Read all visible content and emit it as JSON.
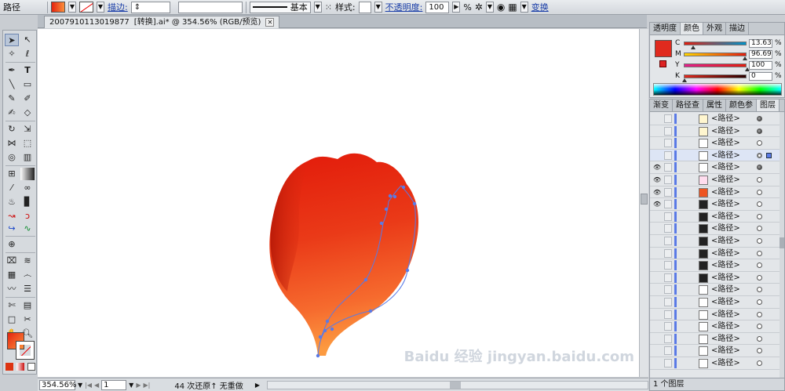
{
  "control_bar": {
    "object_type": "路径",
    "stroke_label": "描边:",
    "stroke_profile": "基本",
    "style_label": "样式:",
    "opacity_label": "不透明度:",
    "opacity_value": "100",
    "opacity_unit": "%",
    "transform_label": "变换"
  },
  "document": {
    "file_id": "200791011301987​7",
    "tab_title": "[转换].ai* @ 354.56% (RGB/预览)",
    "zoom": "354.56%",
    "artboard": "1",
    "history_status": "44 次还原↑ 无重做"
  },
  "color_panel": {
    "tabs": [
      "透明度",
      "颜色",
      "外观",
      "描边"
    ],
    "active_tab": "颜色",
    "channels": [
      {
        "label": "C",
        "value": "13.63",
        "percent": 13.63
      },
      {
        "label": "M",
        "value": "96.69",
        "percent": 96.69
      },
      {
        "label": "Y",
        "value": "100",
        "percent": 100
      },
      {
        "label": "K",
        "value": "0",
        "percent": 0
      }
    ],
    "fill_color": "#e02a1e"
  },
  "layers_panel": {
    "tabs": [
      "渐变",
      "路径查",
      "属性",
      "颜色参",
      "图层"
    ],
    "active_tab": "图层",
    "rows": [
      {
        "name": "<路径>",
        "visible": false,
        "target": "filled"
      },
      {
        "name": "<路径>",
        "visible": false,
        "target": "filled"
      },
      {
        "name": "<路径>",
        "visible": false,
        "target": "empty"
      },
      {
        "name": "<路径>",
        "visible": false,
        "target": "selected"
      },
      {
        "name": "<路径>",
        "visible": true,
        "target": "filled"
      },
      {
        "name": "<路径>",
        "visible": true,
        "target": "empty"
      },
      {
        "name": "<路径>",
        "visible": true,
        "target": "empty"
      },
      {
        "name": "<路径>",
        "visible": true,
        "target": "empty"
      },
      {
        "name": "<路径>",
        "visible": false,
        "target": "empty"
      },
      {
        "name": "<路径>",
        "visible": false,
        "target": "empty"
      },
      {
        "name": "<路径>",
        "visible": false,
        "target": "empty"
      },
      {
        "name": "<路径>",
        "visible": false,
        "target": "empty"
      },
      {
        "name": "<路径>",
        "visible": false,
        "target": "empty"
      },
      {
        "name": "<路径>",
        "visible": false,
        "target": "empty"
      },
      {
        "name": "<路径>",
        "visible": false,
        "target": "empty"
      },
      {
        "name": "<路径>",
        "visible": false,
        "target": "empty"
      },
      {
        "name": "<路径>",
        "visible": false,
        "target": "empty"
      },
      {
        "name": "<路径>",
        "visible": false,
        "target": "empty"
      },
      {
        "name": "<路径>",
        "visible": false,
        "target": "empty"
      },
      {
        "name": "<路径>",
        "visible": false,
        "target": "empty"
      },
      {
        "name": "<路径>",
        "visible": false,
        "target": "empty"
      }
    ],
    "footer": "1 个图层"
  },
  "colors": {
    "accent": "#5a7ae6",
    "petal_top": "#e4230f",
    "petal_bottom": "#fb8f3c"
  },
  "watermark": "Baidu 经验  jingyan.baidu.com"
}
